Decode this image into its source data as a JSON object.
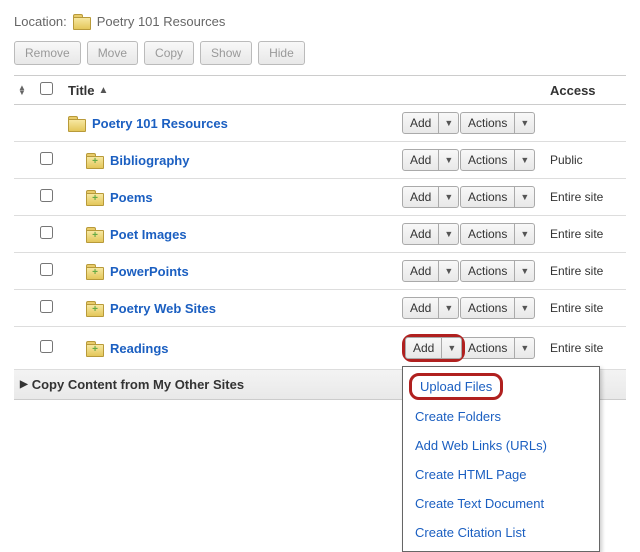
{
  "location": {
    "label": "Location:",
    "name": "Poetry 101 Resources"
  },
  "toolbar": {
    "remove": "Remove",
    "move": "Move",
    "copy": "Copy",
    "show": "Show",
    "hide": "Hide"
  },
  "columns": {
    "title": "Title",
    "access": "Access"
  },
  "buttons": {
    "add": "Add",
    "actions": "Actions"
  },
  "rows": [
    {
      "name": "Poetry 101 Resources",
      "access": "",
      "checkbox": false,
      "indent": false,
      "plus": false
    },
    {
      "name": "Bibliography",
      "access": "Public",
      "checkbox": true,
      "indent": true,
      "plus": true
    },
    {
      "name": "Poems",
      "access": "Entire site",
      "checkbox": true,
      "indent": true,
      "plus": true
    },
    {
      "name": "Poet Images",
      "access": "Entire site",
      "checkbox": true,
      "indent": true,
      "plus": true
    },
    {
      "name": "PowerPoints",
      "access": "Entire site",
      "checkbox": true,
      "indent": true,
      "plus": true
    },
    {
      "name": "Poetry Web Sites",
      "access": "Entire site",
      "checkbox": true,
      "indent": true,
      "plus": true
    },
    {
      "name": "Readings",
      "access": "Entire site",
      "checkbox": true,
      "indent": true,
      "plus": true,
      "addHighlighted": true
    }
  ],
  "footer": {
    "label": "Copy Content from My Other Sites"
  },
  "menu": {
    "items": [
      "Upload Files",
      "Create Folders",
      "Add Web Links (URLs)",
      "Create HTML Page",
      "Create Text Document",
      "Create Citation List"
    ],
    "highlightedIndex": 0
  }
}
